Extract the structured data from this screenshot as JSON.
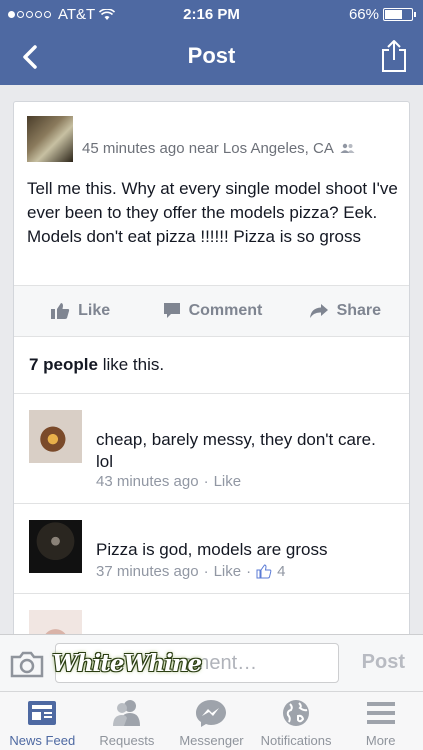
{
  "status": {
    "carrier": "AT&T",
    "time": "2:16 PM",
    "battery": "66%",
    "battery_level": 0.66
  },
  "nav": {
    "title": "Post"
  },
  "post": {
    "meta": "45 minutes ago near Los Angeles, CA",
    "text": "Tell me this. Why at every single model shoot I've ever been to they offer the models pizza? Eek. Models don't eat pizza !!!!!! Pizza is so gross"
  },
  "actions": {
    "like": "Like",
    "comment": "Comment",
    "share": "Share"
  },
  "likes": {
    "count": "7 people",
    "suffix": " like this."
  },
  "comments": [
    {
      "text": "cheap, barely messy, they don't care. lol",
      "time": "43 minutes ago",
      "like": "Like"
    },
    {
      "text": "Pizza is god, models are gross",
      "time": "37 minutes ago",
      "like": "Like",
      "likes": "4"
    }
  ],
  "compose": {
    "placeholder": "mment…",
    "post": "Post",
    "watermark": "WhiteWhine"
  },
  "tabs": [
    {
      "label": "News Feed",
      "icon": "news-feed-icon"
    },
    {
      "label": "Requests",
      "icon": "requests-icon"
    },
    {
      "label": "Messenger",
      "icon": "messenger-icon"
    },
    {
      "label": "Notifications",
      "icon": "globe-icon"
    },
    {
      "label": "More",
      "icon": "menu-icon"
    }
  ],
  "colors": {
    "brand": "#4e69a2",
    "tab_inactive": "#8f949c"
  }
}
